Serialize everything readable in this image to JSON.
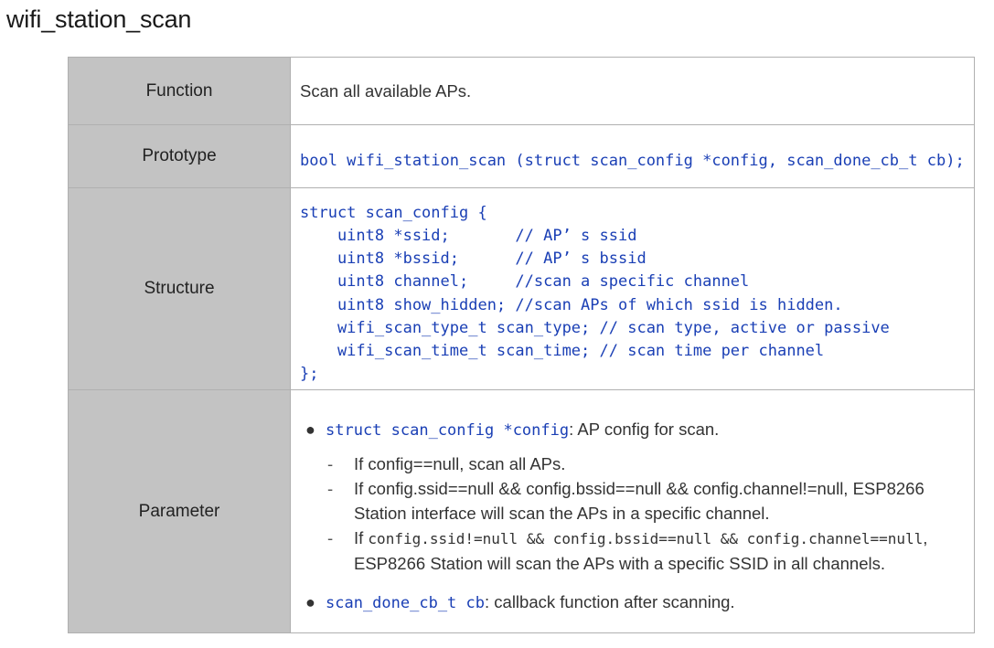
{
  "title": "wifi_station_scan",
  "rows": {
    "function": {
      "label": "Function",
      "text": "Scan all available APs."
    },
    "prototype": {
      "label": "Prototype",
      "code": "bool wifi_station_scan (struct scan_config *config, scan_done_cb_t cb);"
    },
    "structure": {
      "label": "Structure",
      "lines": [
        "struct scan_config {",
        "    uint8 *ssid;       // AP’ s ssid",
        "    uint8 *bssid;      // AP’ s bssid",
        "    uint8 channel;     //scan a specific channel",
        "    uint8 show_hidden; //scan APs of which ssid is hidden.",
        "    wifi_scan_type_t scan_type; // scan type, active or passive",
        "    wifi_scan_time_t scan_time; // scan time per channel",
        "};"
      ]
    },
    "parameter": {
      "label": "Parameter",
      "bullet1": {
        "code": "struct scan_config *config",
        "text": ": AP config for scan."
      },
      "sub1": "If config==null, scan all APs.",
      "sub2": "If config.ssid==null && config.bssid==null && config.channel!=null, ESP8266 Station interface will scan the APs in a specific channel.",
      "sub3": {
        "prefix": "If ",
        "mono": "config.ssid!=null && config.bssid==null && config.channel==null",
        "suffix": ", ESP8266 Station will scan the APs with a specific SSID in all channels."
      },
      "bullet2": {
        "code": "scan_done_cb_t cb",
        "text": ": callback function after scanning."
      }
    }
  }
}
